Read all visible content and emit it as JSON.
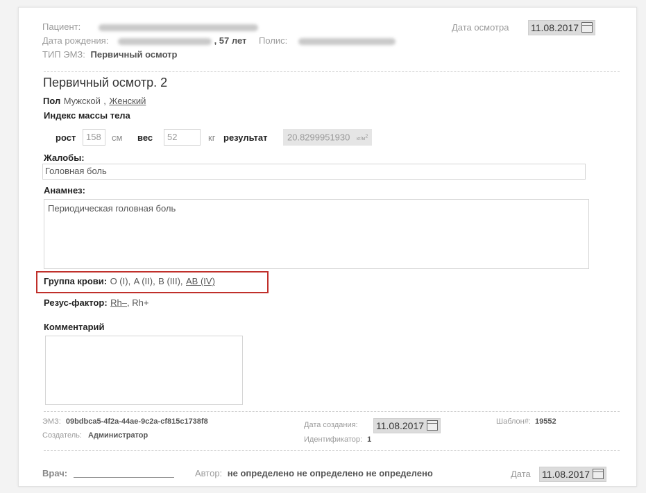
{
  "header": {
    "patient_label": "Пациент:",
    "birth_label": "Дата рождения:",
    "age": ", 57 лет",
    "policy_label": "Полис:",
    "emz_type_label": "ТИП ЭМЗ:",
    "emz_type_value": "Первичный осмотр",
    "exam_date_label": "Дата осмотра",
    "exam_date_value": "11.08.2017"
  },
  "form": {
    "title": "Первичный осмотр. 2",
    "sex_label": "Пол",
    "sex_male": "Мужской",
    "sex_sep": ",",
    "sex_female": "Женский",
    "bmi_label": "Индекс массы тела",
    "height_label": "рост",
    "height_value": "158",
    "height_unit": "см",
    "weight_label": "вес",
    "weight_value": "52",
    "weight_unit": "кг",
    "result_label": "результат",
    "result_value": "20.8299951930",
    "result_unit": "кг/м",
    "result_unit_sup": "2",
    "complaints_label": "Жалобы:",
    "complaints_value": "Головная боль",
    "anamnesis_label": "Анамнез:",
    "anamnesis_value": "Периодическая головная боль",
    "blood_label": "Группа крови:",
    "blood_options": [
      "O (I),",
      "A (II),",
      "B (III),",
      "AB (IV)"
    ],
    "rh_label": "Резус-фактор:",
    "rh_options": [
      "Rh–",
      ", Rh+"
    ],
    "comment_label": "Комментарий",
    "comment_value": ""
  },
  "meta": {
    "emz_label": "ЭМЗ:",
    "emz_value": "09bdbca5-4f2a-44ae-9c2a-cf815c1738f8",
    "creator_label": "Создатель:",
    "creator_value": "Администратор",
    "created_date_label": "Дата создания:",
    "created_date_value": "11.08.2017",
    "identifier_label": "Идентификатор:",
    "identifier_value": "1",
    "template_label": "Шаблон#:",
    "template_value": "19552"
  },
  "footer": {
    "doctor_label": "Врач:",
    "author_label": "Автор:",
    "author_value": "не определено не определено не определено",
    "date_label": "Дата",
    "date_value": "11.08.2017"
  },
  "colors": {
    "highlight_border": "#c0302b"
  }
}
